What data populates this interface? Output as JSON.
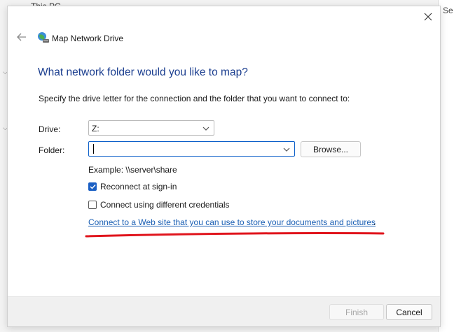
{
  "background": {
    "explorer_title": "This PC",
    "right_panel_text": "Se"
  },
  "dialog": {
    "title": "Map Network Drive",
    "heading": "What network folder would you like to map?",
    "instruction": "Specify the drive letter for the connection and the folder that you want to connect to:",
    "drive_label": "Drive:",
    "drive_value": "Z:",
    "folder_label": "Folder:",
    "folder_value": "",
    "browse_label": "Browse...",
    "example_text": "Example: \\\\server\\share",
    "reconnect_label": "Reconnect at sign-in",
    "reconnect_checked": true,
    "credentials_label": "Connect using different credentials",
    "credentials_checked": false,
    "link_text": "Connect to a Web site that you can use to store your documents and pictures",
    "link_tail": ".",
    "finish_label": "Finish",
    "cancel_label": "Cancel"
  },
  "colors": {
    "heading": "#1b3e8f",
    "link": "#1a5fb4",
    "checkbox_accent": "#1a5fc4",
    "annotation_underline": "#e0141c"
  },
  "icons": {
    "back": "back-arrow-icon",
    "app": "network-drive-icon",
    "close": "close-icon",
    "dropdown": "chevron-down-icon",
    "check": "checkmark-icon"
  }
}
